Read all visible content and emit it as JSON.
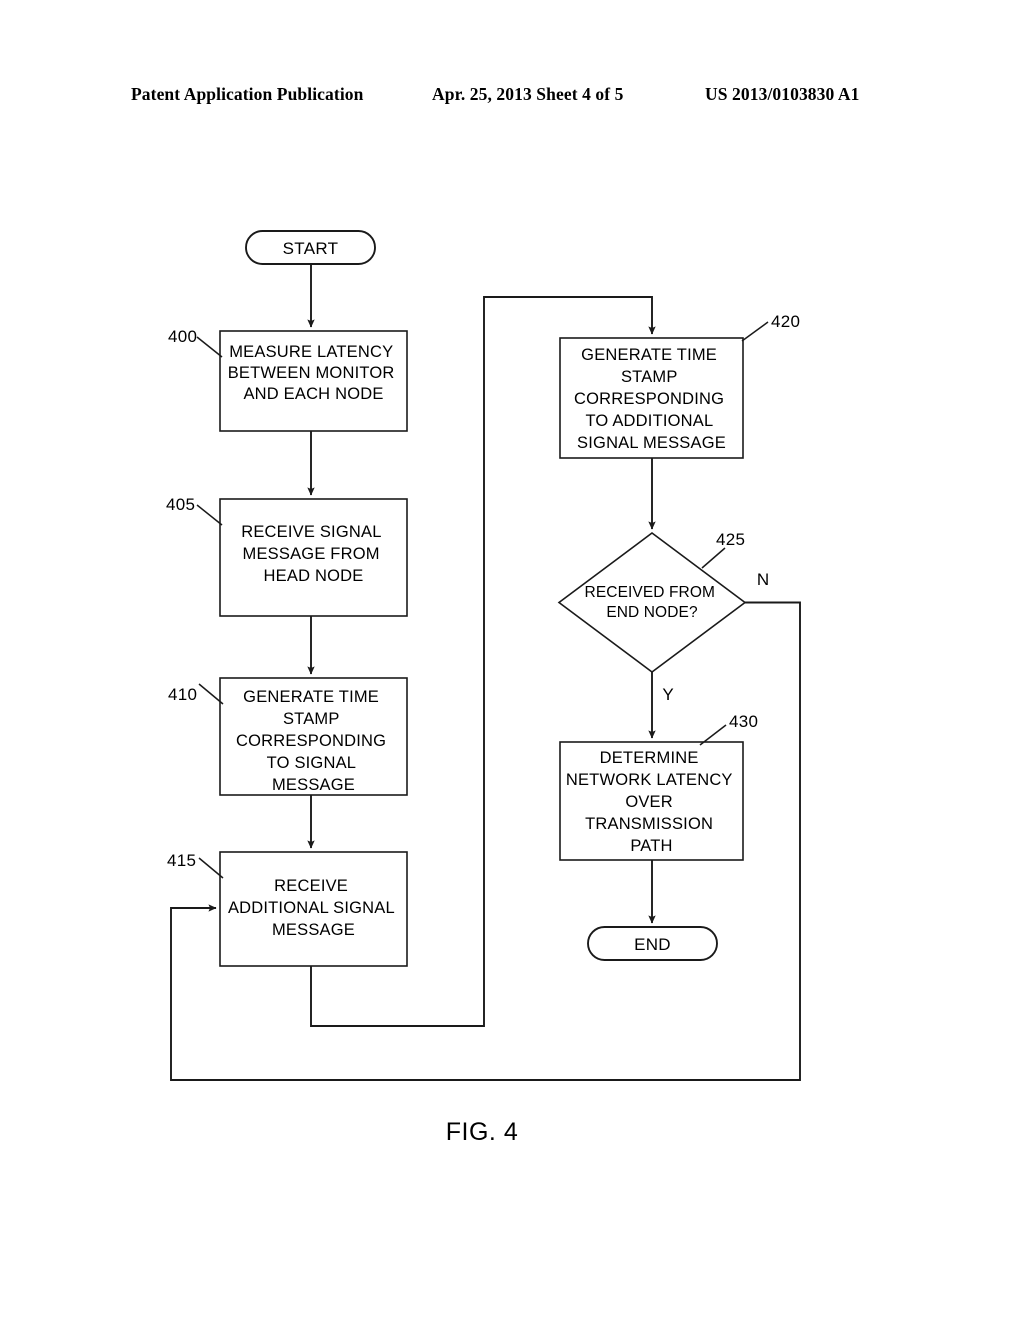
{
  "header": {
    "left": "Patent Application Publication",
    "middle": "Apr. 25, 2013  Sheet 4 of 5",
    "right": "US 2013/0103830 A1"
  },
  "figure": {
    "caption": "FIG. 4",
    "nodes": {
      "start": {
        "label": "START",
        "ref": ""
      },
      "step400": {
        "ref": "400",
        "lines": [
          "MEASURE LATENCY",
          "BETWEEN MONITOR",
          "AND EACH NODE"
        ]
      },
      "step405": {
        "ref": "405",
        "lines": [
          "RECEIVE SIGNAL",
          "MESSAGE FROM",
          "HEAD NODE"
        ]
      },
      "step410": {
        "ref": "410",
        "lines": [
          "GENERATE TIME",
          "STAMP",
          "CORRESPONDING",
          "TO SIGNAL",
          "MESSAGE"
        ]
      },
      "step415": {
        "ref": "415",
        "lines": [
          "RECEIVE",
          "ADDITIONAL SIGNAL",
          "MESSAGE"
        ]
      },
      "step420": {
        "ref": "420",
        "lines": [
          "GENERATE TIME",
          "STAMP",
          "CORRESPONDING",
          "TO ADDITIONAL",
          "SIGNAL MESSAGE"
        ]
      },
      "decision425": {
        "ref": "425",
        "lines": [
          "RECEIVED FROM",
          "END NODE?"
        ],
        "yes_label": "Y",
        "no_label": "N"
      },
      "step430": {
        "ref": "430",
        "lines": [
          "DETERMINE",
          "NETWORK LATENCY",
          "OVER",
          "TRANSMISSION",
          "PATH"
        ]
      },
      "end": {
        "label": "END",
        "ref": ""
      }
    }
  },
  "colors": {
    "ink": "#1a1a1a",
    "paper": "#ffffff"
  }
}
